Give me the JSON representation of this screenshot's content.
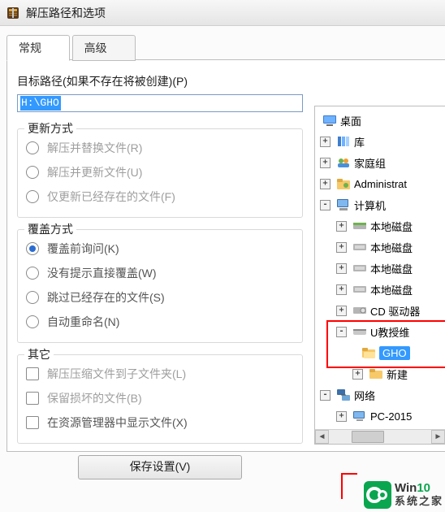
{
  "window": {
    "title": "解压路径和选项"
  },
  "tabs": {
    "general": "常规",
    "advanced": "高级"
  },
  "path": {
    "label": "目标路径(如果不存在将被创建)(P)",
    "value": "H:\\GHO"
  },
  "groups": {
    "update": {
      "legend": "更新方式",
      "opt_replace": "解压并替换文件(R)",
      "opt_update": "解压并更新文件(U)",
      "opt_freshen": "仅更新已经存在的文件(F)"
    },
    "overwrite": {
      "legend": "覆盖方式",
      "opt_ask": "覆盖前询问(K)",
      "opt_silent": "没有提示直接覆盖(W)",
      "opt_skip": "跳过已经存在的文件(S)",
      "opt_rename": "自动重命名(N)"
    },
    "other": {
      "legend": "其它",
      "opt_subfolder": "解压压缩文件到子文件夹(L)",
      "opt_keep_broken": "保留损坏的文件(B)",
      "opt_explorer": "在资源管理器中显示文件(X)"
    }
  },
  "save_button": "保存设置(V)",
  "tree": {
    "desktop": "桌面",
    "libraries": "库",
    "homegroup": "家庭组",
    "admin": "Administrat",
    "computer": "计算机",
    "local_disk": "本地磁盘",
    "cd_drive": "CD 驱动器",
    "u_teacher": "U教授维",
    "gho": "GHO",
    "new": "新建",
    "network": "网络",
    "pc2015": "PC-2015"
  },
  "watermark": {
    "line1a": "Win",
    "line1b": "10",
    "line2": "系统之家"
  }
}
